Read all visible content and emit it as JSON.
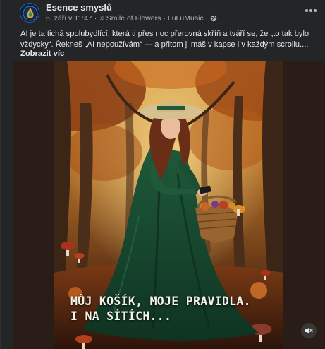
{
  "post": {
    "page_name": "Esence smyslů",
    "date": "6. září v 11:47",
    "music_track": "Smile of Flowers",
    "music_artist": "LuLuMusic",
    "separator": "·",
    "caption_line1": "AI je ta tichá spolubydlící, která ti přes noc přerovná skříň a tváří se, že „to tak bylo",
    "caption_line2": "vždycky“. Řekneš „AI nepoužívám“ — a přitom ji máš v kapse i v každým scrollu....",
    "see_more_label": "Zobrazit víc"
  },
  "media": {
    "overlay_line1": "MŮJ KOŠÍK, MOJE PRAVIDLA.",
    "overlay_line2": "I NA SÍTÍCH..."
  },
  "icons": {
    "avatar": "drop-logo-icon",
    "music": "music-note-icon",
    "privacy": "globe-icon",
    "menu": "more-options-icon",
    "sound": "speaker-muted-icon"
  },
  "colors": {
    "background": "#242526",
    "text_primary": "#e4e6eb",
    "text_secondary": "#b0b3b8",
    "dress": "#1f5a3a",
    "foliage": "#c8661f"
  }
}
